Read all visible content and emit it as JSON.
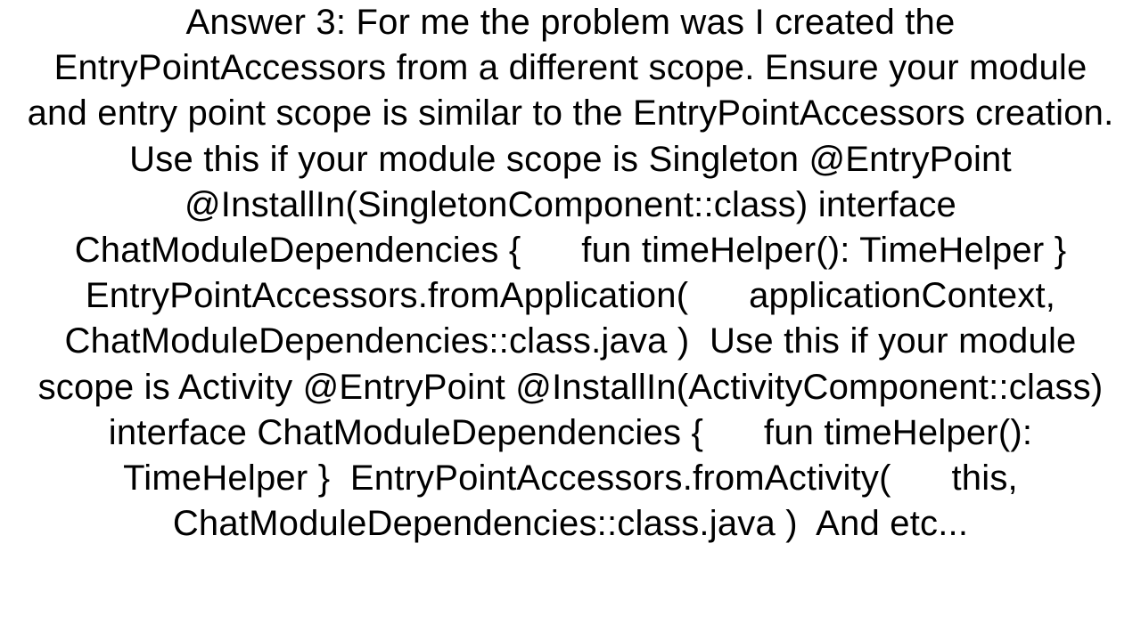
{
  "document": {
    "body": "Answer 3: For me the problem was I created the EntryPointAccessors from a different scope. Ensure your module and entry point scope is similar to the EntryPointAccessors creation. Use this if your module scope is Singleton @EntryPoint @InstallIn(SingletonComponent::class) interface ChatModuleDependencies {      fun timeHelper(): TimeHelper }  EntryPointAccessors.fromApplication(      applicationContext,     ChatModuleDependencies::class.java )  Use this if your module scope is Activity @EntryPoint @InstallIn(ActivityComponent::class) interface ChatModuleDependencies {      fun timeHelper(): TimeHelper }  EntryPointAccessors.fromActivity(      this,     ChatModuleDependencies::class.java )  And etc..."
  }
}
